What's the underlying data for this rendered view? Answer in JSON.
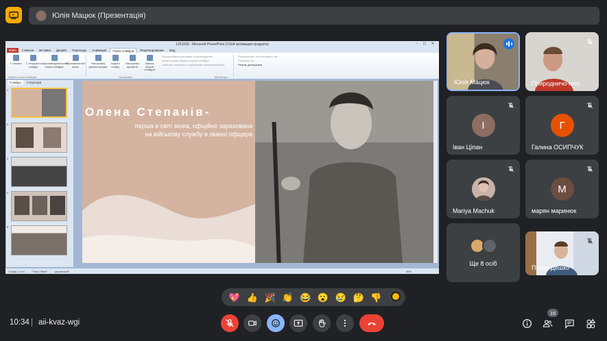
{
  "header": {
    "presenter_label": "Юлія Мацюк (Презентація)"
  },
  "shared_screen": {
    "window_title": "1251035 - Microsoft PowerPoint (Сбой активации продукта)",
    "ribbon_tabs": [
      "Файл",
      "Главная",
      "Вставка",
      "Дизайн",
      "Переходы",
      "Анимация",
      "Показ слайдов",
      "Рецензирование",
      "Вид"
    ],
    "ribbon_buttons": [
      "С начала",
      "С текущего слайда",
      "Широковещательный показ слайдов",
      "Произвольный показ",
      "Настройка демонстрации",
      "Скрыть слайд",
      "Настройка времени",
      "Запись показа слайдов"
    ],
    "ribbon_checks": [
      "Воспроизвести речевое сопровождение",
      "Использовать время показа слайдов",
      "Показать элементы управления проигрывателем"
    ],
    "ribbon_options": [
      "Разрешение:",
      "Показать на:",
      "Режим докладчика"
    ],
    "ribbon_option_value": "Использовать тек...",
    "group_labels": [
      "Начать показ слайдов",
      "Настройка",
      "Мониторы"
    ],
    "pane_tabs": [
      "Слайды",
      "Структура"
    ],
    "slide_numbers": [
      "1",
      "2",
      "3",
      "4",
      "5"
    ],
    "slide": {
      "title": "Олена Степанів-",
      "subtitle_lines": [
        "перша в світі жінка, офіційно зарахована",
        "на військову службу в званні офіцера"
      ]
    },
    "status": {
      "slide_counter": "Слайд 1 из 6",
      "theme": "\"Тема Office\"",
      "language": "украинский",
      "zoom": "56%"
    }
  },
  "participants": [
    {
      "name": "Юлія Мацюк",
      "type": "video",
      "speaking": true
    },
    {
      "name": "Природничо-геог...",
      "type": "video",
      "muted": true
    },
    {
      "name": "Іван Ціпан",
      "initial": "І",
      "color": "#8d6e63",
      "muted": true
    },
    {
      "name": "Галина ОСИПЧУК",
      "initial": "Г",
      "color": "#e65100",
      "muted": true
    },
    {
      "name": "Mariya Machuk",
      "type": "photo",
      "muted": true
    },
    {
      "name": "марян маринюк",
      "initial": "М",
      "color": "#6d4c41",
      "muted": true
    },
    {
      "name": "Ще 8 осіб",
      "type": "more"
    },
    {
      "name": "Петро Дешко",
      "type": "video",
      "muted": true
    }
  ],
  "reactions": [
    "💖",
    "👍",
    "🎉",
    "👏",
    "😂",
    "😮",
    "😢",
    "🤔",
    "👎"
  ],
  "bottom_bar": {
    "time": "10:34",
    "separator": "|",
    "meeting_code": "aii-kvaz-wgi",
    "participant_count": "16"
  },
  "colors": {
    "background": "#202124",
    "tile": "#3c4043",
    "accent_blue": "#8ab4f8",
    "danger_red": "#ea4335",
    "present_yellow": "#f9ab00"
  }
}
